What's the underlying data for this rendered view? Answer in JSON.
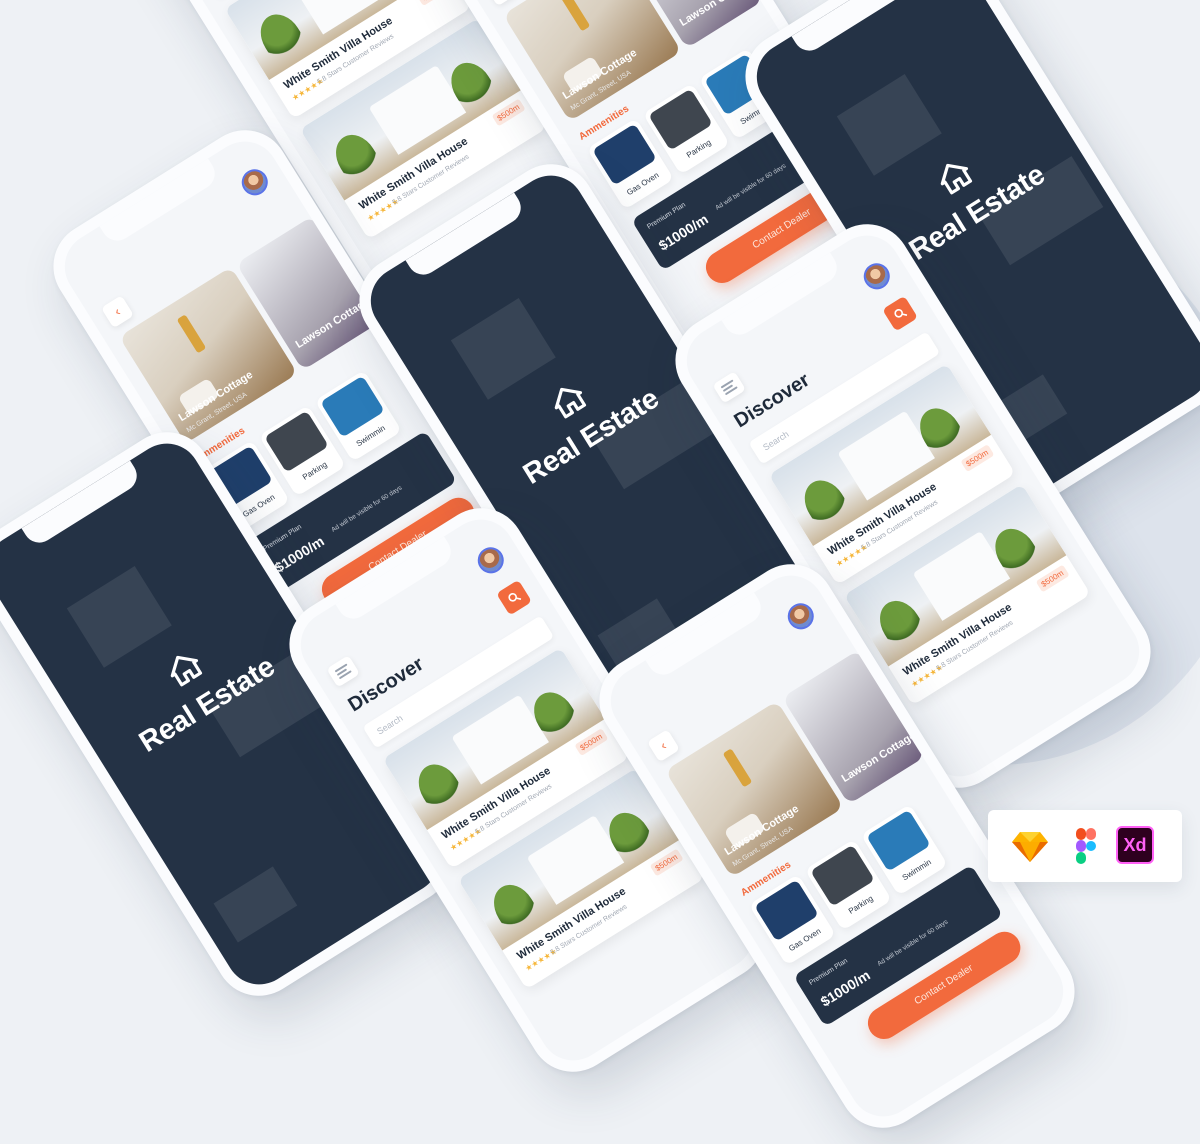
{
  "splash": {
    "title": "Real Estate"
  },
  "discover": {
    "title": "Discover",
    "search_placeholder": "Search",
    "listings": [
      {
        "title": "White Smith Villa House",
        "price": "$500m",
        "stars": "★★★★★",
        "reviews": "5.8 Stars Customer Reviews"
      },
      {
        "title": "White Smith Villa House",
        "price": "$500m",
        "stars": "★★★★★",
        "reviews": "5.8 Stars Customer Reviews"
      }
    ]
  },
  "detail": {
    "rooms": [
      {
        "name": "Lawson Cottage",
        "location": "Mc Grant, Street, USA"
      },
      {
        "name": "Lawson Cottage",
        "location": ""
      }
    ],
    "amenities_title": "Ammenities",
    "amenities": [
      "Gas Oven",
      "Parking",
      "Swimmin"
    ],
    "plan_name": "Premium Plan",
    "plan_price": "$1000/m",
    "plan_note": "Ad will be visible for 60 days",
    "contact_label": "Contact Dealer"
  },
  "tools": {
    "xd_label": "Xd",
    "icons": [
      "sketch-icon",
      "figma-icon",
      "xd-icon"
    ]
  },
  "colors": {
    "accent": "#f26a3d",
    "navy": "#243245",
    "background": "#eef1f5"
  }
}
